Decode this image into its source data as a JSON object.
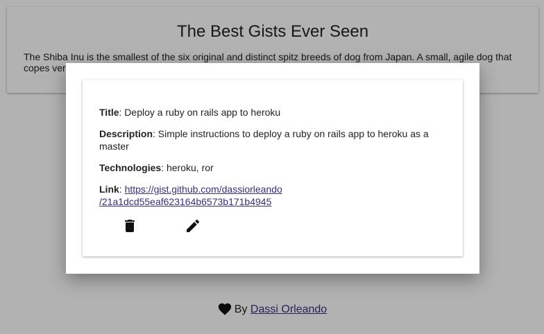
{
  "header": {
    "title": "The Best Gists Ever Seen",
    "description": "The Shiba Inu is the smallest of the six original and distinct spitz breeds of dog from Japan. A small, agile dog that copes very"
  },
  "modal": {
    "gist": {
      "title_label": "Title",
      "title_value": ": Deploy a ruby on rails app to heroku",
      "description_label": "Description",
      "description_value": ": Simple instructions to deploy a ruby on rails app to heroku as a master",
      "technologies_label": "Technologies",
      "technologies_value": ": heroku, ror",
      "link_label": "Link",
      "link_separator": ": ",
      "link_url": "https://gist.github.com/dassiorleando/21a1dcd55eaf623164b6573b171b4945",
      "link_text_line1": "https://gist.github.com/dassiorleando",
      "link_text_line2": "/21a1dcd55eaf623164b6573b171b4945"
    },
    "actions": {
      "delete_icon": "trash-icon",
      "edit_icon": "pencil-icon"
    }
  },
  "footer": {
    "heart_icon": "heart-icon",
    "by_text": "By",
    "author_name": "Dassi Orleando"
  },
  "colors": {
    "link": "#3a2d7a",
    "overlay": "rgba(0,0,0,0.3)"
  }
}
